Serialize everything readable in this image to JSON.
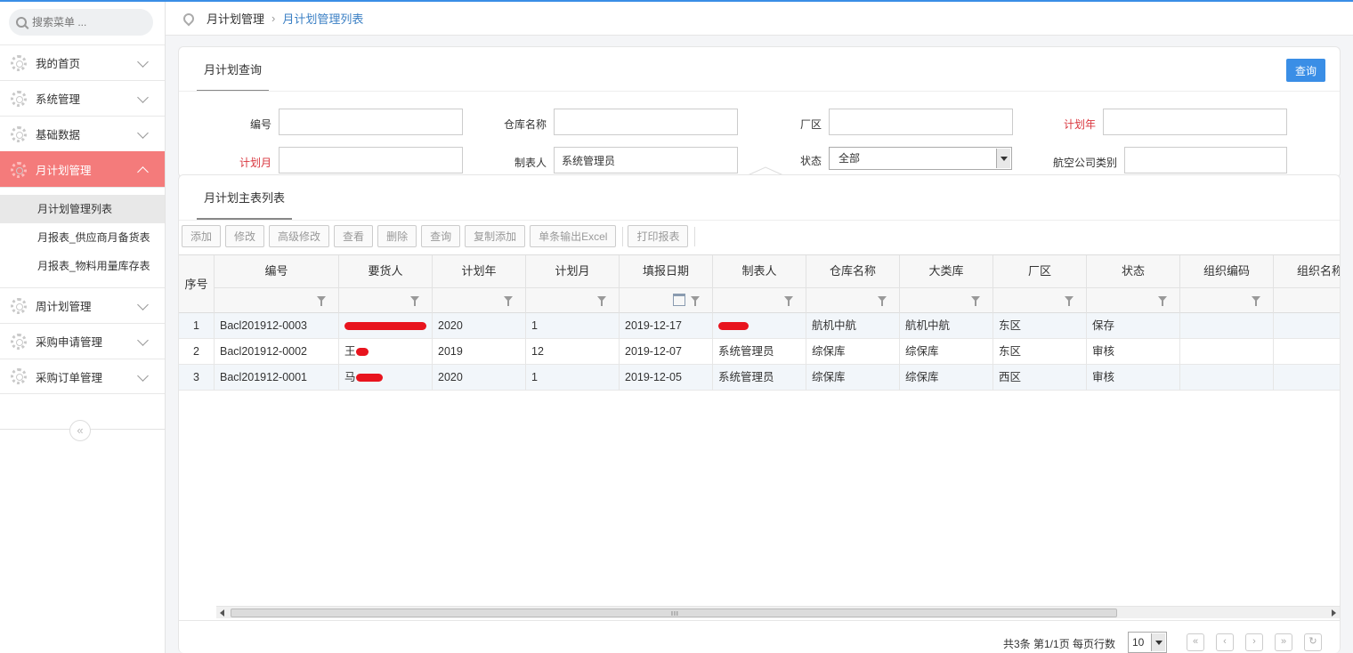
{
  "sidebar": {
    "search_placeholder": "搜索菜单 ...",
    "items": [
      {
        "label": "我的首页"
      },
      {
        "label": "系统管理"
      },
      {
        "label": "基础数据"
      },
      {
        "label": "月计划管理"
      },
      {
        "label": "周计划管理"
      },
      {
        "label": "采购申请管理"
      },
      {
        "label": "采购订单管理"
      }
    ],
    "sub_items": [
      {
        "label": "月计划管理列表"
      },
      {
        "label": "月报表_供应商月备货表"
      },
      {
        "label": "月报表_物料用量库存表"
      }
    ],
    "collapse_glyph": "«"
  },
  "breadcrumb": {
    "parent": "月计划管理",
    "separator": "›",
    "current": "月计划管理列表"
  },
  "query": {
    "title": "月计划查询",
    "button": "查询",
    "fields": {
      "bianhao": {
        "label": "编号",
        "value": ""
      },
      "cangku": {
        "label": "仓库名称",
        "value": ""
      },
      "changqu": {
        "label": "厂区",
        "value": ""
      },
      "jihuanian": {
        "label": "计划年",
        "value": ""
      },
      "jihuayue": {
        "label": "计划月",
        "value": ""
      },
      "zhibiaoren": {
        "label": "制表人",
        "value": "系统管理员"
      },
      "zhuangtai": {
        "label": "状态",
        "value": "全部"
      },
      "hangkong": {
        "label": "航空公司类别",
        "value": ""
      }
    }
  },
  "list": {
    "title": "月计划主表列表",
    "toolbar": [
      "添加",
      "修改",
      "高级修改",
      "查看",
      "删除",
      "查询",
      "复制添加",
      "单条输出Excel",
      "打印报表"
    ],
    "row_header": "序号",
    "columns": [
      "编号",
      "要货人",
      "计划年",
      "计划月",
      "填报日期",
      "制表人",
      "仓库名称",
      "大类库",
      "厂区",
      "状态",
      "组织编码",
      "组织名称"
    ],
    "rows": [
      {
        "idx": "1",
        "bianhao": "Bacl201912-0003",
        "yaohuoren": "",
        "nian": "2020",
        "yue": "1",
        "riqi": "2019-12-17",
        "zhibiaoren": "",
        "cangku": "航机中航",
        "daleiku": "航机中航",
        "changqu": "东区",
        "zhuangtai": "保存",
        "zuzhibianma": "",
        "zuzhimingcheng": ""
      },
      {
        "idx": "2",
        "bianhao": "Bacl201912-0002",
        "yaohuoren": "王",
        "nian": "2019",
        "yue": "12",
        "riqi": "2019-12-07",
        "zhibiaoren": "系统管理员",
        "cangku": "综保库",
        "daleiku": "综保库",
        "changqu": "东区",
        "zhuangtai": "审核",
        "zuzhibianma": "",
        "zuzhimingcheng": ""
      },
      {
        "idx": "3",
        "bianhao": "Bacl201912-0001",
        "yaohuoren": "马",
        "nian": "2020",
        "yue": "1",
        "riqi": "2019-12-05",
        "zhibiaoren": "系统管理员",
        "cangku": "综保库",
        "daleiku": "综保库",
        "changqu": "西区",
        "zhuangtai": "审核",
        "zuzhibianma": "",
        "zuzhimingcheng": ""
      }
    ],
    "scroll_grip": "III"
  },
  "pager": {
    "summary": "共3条 第1/1页  每页行数",
    "page_size": "10",
    "first": "«",
    "prev": "‹",
    "next": "›",
    "last": "»",
    "refresh": "↻"
  },
  "colors": {
    "accent": "#3a8ee6",
    "active_menu": "#f47b7b",
    "required": "#d9363e",
    "redaction": "#e8141e"
  }
}
